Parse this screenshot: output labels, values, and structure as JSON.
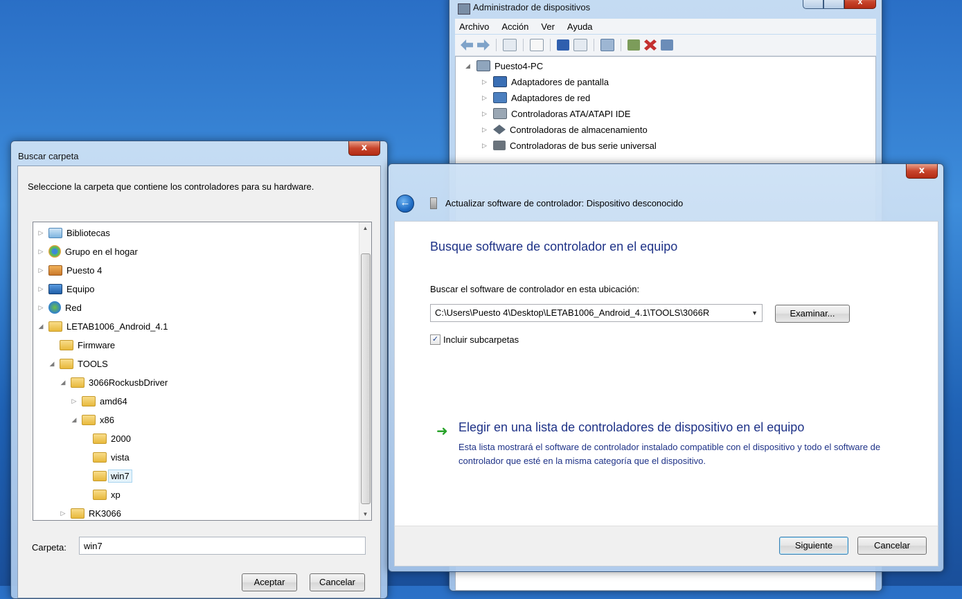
{
  "device_manager": {
    "title": "Administrador de dispositivos",
    "menu": [
      "Archivo",
      "Acción",
      "Ver",
      "Ayuda"
    ],
    "tree": {
      "root": "Puesto4-PC",
      "items": [
        "Adaptadores de pantalla",
        "Adaptadores de red",
        "Controladoras ATA/ATAPI IDE",
        "Controladoras de almacenamiento",
        "Controladoras de bus serie universal"
      ]
    }
  },
  "browse_dialog": {
    "title": "Buscar carpeta",
    "close_label": "x",
    "prompt": "Seleccione la carpeta que contiene los controladores para su hardware.",
    "folders": [
      {
        "label": "Bibliotecas",
        "icon": "libraries-icon"
      },
      {
        "label": "Grupo en el hogar",
        "icon": "homegroup-icon"
      },
      {
        "label": "Puesto 4",
        "icon": "user-folder-icon"
      },
      {
        "label": "Equipo",
        "icon": "computer-icon"
      },
      {
        "label": "Red",
        "icon": "network-icon"
      },
      {
        "label": "LETAB1006_Android_4.1",
        "icon": "folder-icon"
      },
      {
        "label": "Firmware",
        "icon": "folder-icon"
      },
      {
        "label": "TOOLS",
        "icon": "folder-icon"
      },
      {
        "label": "3066RockusbDriver",
        "icon": "folder-icon"
      },
      {
        "label": "amd64",
        "icon": "folder-icon"
      },
      {
        "label": "x86",
        "icon": "folder-icon"
      },
      {
        "label": "2000",
        "icon": "folder-icon"
      },
      {
        "label": "vista",
        "icon": "folder-icon"
      },
      {
        "label": "win7",
        "icon": "folder-icon",
        "selected": true
      },
      {
        "label": "xp",
        "icon": "folder-icon"
      },
      {
        "label": "RK3066",
        "icon": "folder-icon"
      }
    ],
    "folder_field_label": "Carpeta:",
    "folder_field_value": "win7",
    "ok_label": "Aceptar",
    "cancel_label": "Cancelar"
  },
  "wizard": {
    "close_label": "x",
    "title": "Actualizar software de controlador: Dispositivo desconocido",
    "heading": "Busque software de controlador en el equipo",
    "location_label": "Buscar el software de controlador en esta ubicación:",
    "path_value": "C:\\Users\\Puesto 4\\Desktop\\LETAB1006_Android_4.1\\TOOLS\\3066R",
    "browse_label": "Examinar...",
    "include_subfolders_label": "Incluir subcarpetas",
    "include_subfolders_checked": true,
    "choice_title": "Elegir en una lista de controladores de dispositivo en el equipo",
    "choice_desc": "Esta lista mostrará el software de controlador instalado compatible con el dispositivo y todo el software de controlador que esté en la misma categoría que el dispositivo.",
    "next_label": "Siguiente",
    "cancel_label": "Cancelar"
  },
  "colors": {
    "heading_blue": "#1e3287",
    "desktop_blue": "#2a6fc6",
    "close_red": "#c8452c",
    "choice_arrow_green": "#29a32a"
  }
}
